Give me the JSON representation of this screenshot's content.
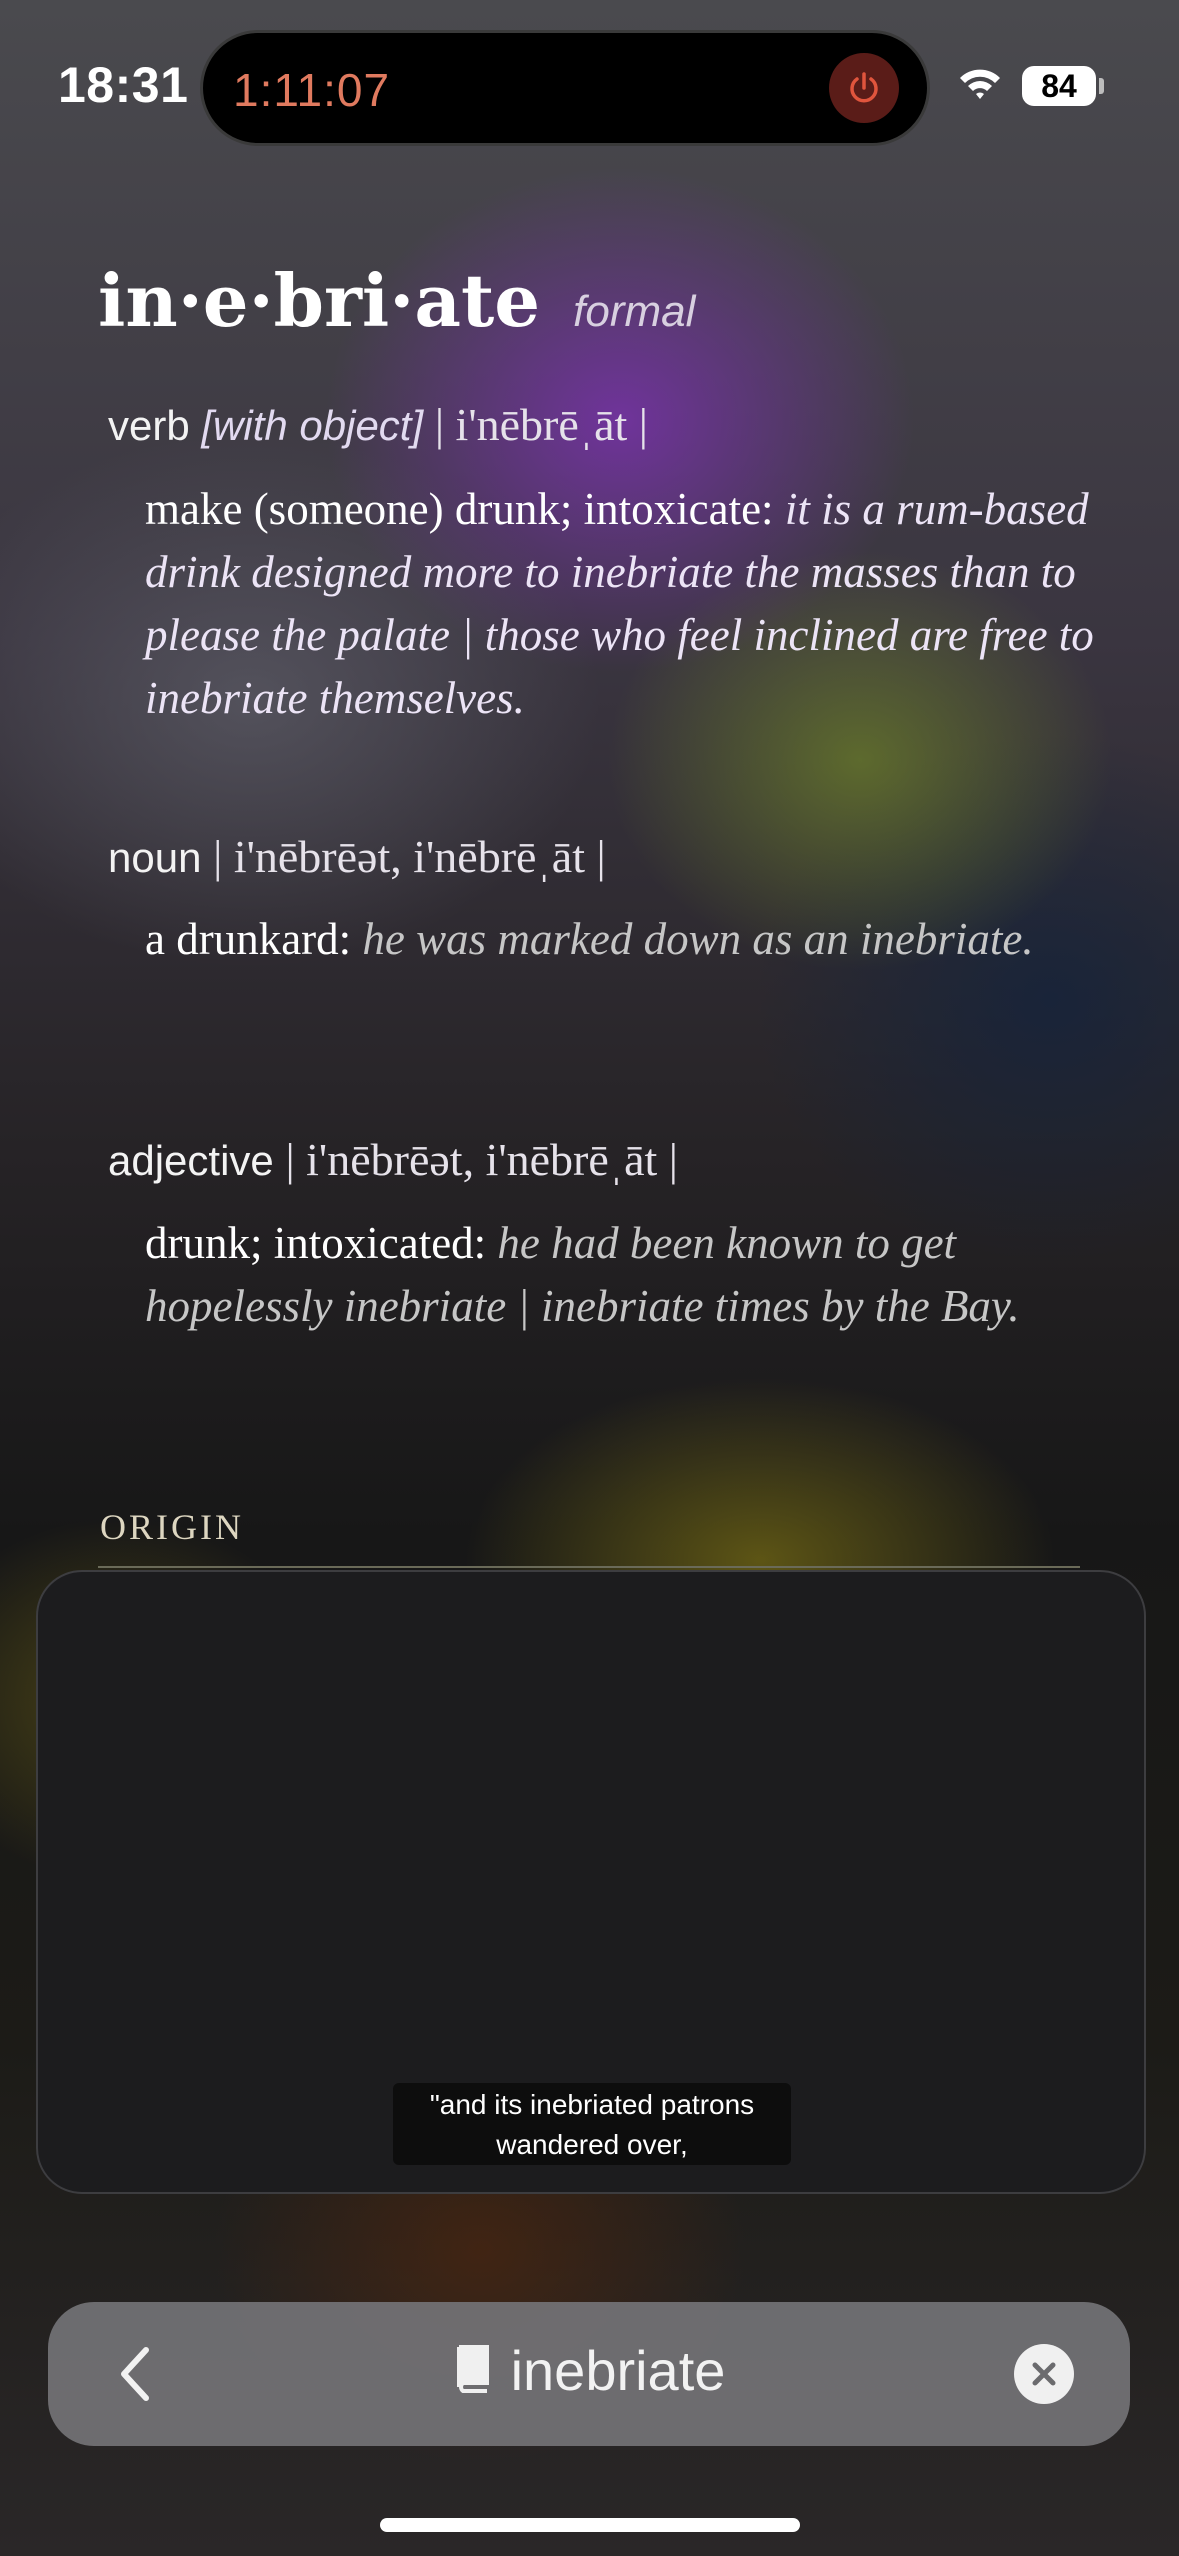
{
  "status_bar": {
    "time": "18:31",
    "timer": "1:11:07",
    "battery": "84",
    "icons": [
      "power-icon",
      "wifi-icon",
      "battery-icon"
    ]
  },
  "entry": {
    "headword": "in·e·bri·ate",
    "register": "formal",
    "senses": [
      {
        "pos": "verb",
        "grammar": "[with object]",
        "pronunciation": "| i'nēbrēˌāt |",
        "definition": "make (someone) drunk; intoxicate:",
        "example": "it is a rum-based drink designed more to inebriate the masses than to please the palate | those who feel inclined are free to inebriate themselves."
      },
      {
        "pos": "noun",
        "grammar": "",
        "pronunciation": "| i'nēbrēət, i'nēbrēˌāt |",
        "definition": "a drunkard:",
        "example": "he was marked down as an inebriate."
      },
      {
        "pos": "adjective",
        "grammar": "",
        "pronunciation": "| i'nēbrēət, i'nēbrēˌāt |",
        "definition": "drunk; intoxicated:",
        "example": "he had been known to get hopelessly inebriate | inebriate times by the Bay."
      }
    ],
    "origin_label": "ORIGIN"
  },
  "video": {
    "caption_line1": "\"and its inebriated patrons",
    "caption_line2": "wandered over,"
  },
  "search_bar": {
    "term": "inebriate",
    "icons": [
      "chevron-left-icon",
      "book-icon",
      "clear-icon"
    ]
  },
  "colors": {
    "timer": "#e07a5f",
    "power_bg": "#5a1c18",
    "panel": "#1c1c1e",
    "search_bar": "#737376"
  }
}
